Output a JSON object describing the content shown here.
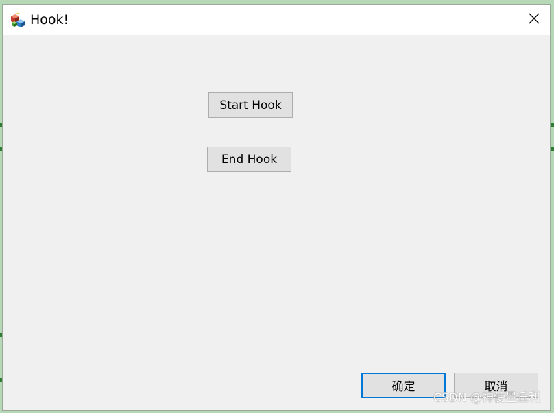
{
  "window": {
    "title": "Hook!",
    "app_icon": "colored-cubes-icon",
    "close_icon": "close-icon"
  },
  "buttons": {
    "start_hook": "Start Hook",
    "end_hook": "End Hook",
    "ok": "确定",
    "cancel": "取消"
  },
  "watermark": "CSDN @神使墨丘利",
  "colors": {
    "default_button_border": "#0078d7",
    "button_face": "#e1e1e1",
    "dialog_background": "#f0f0f0"
  }
}
